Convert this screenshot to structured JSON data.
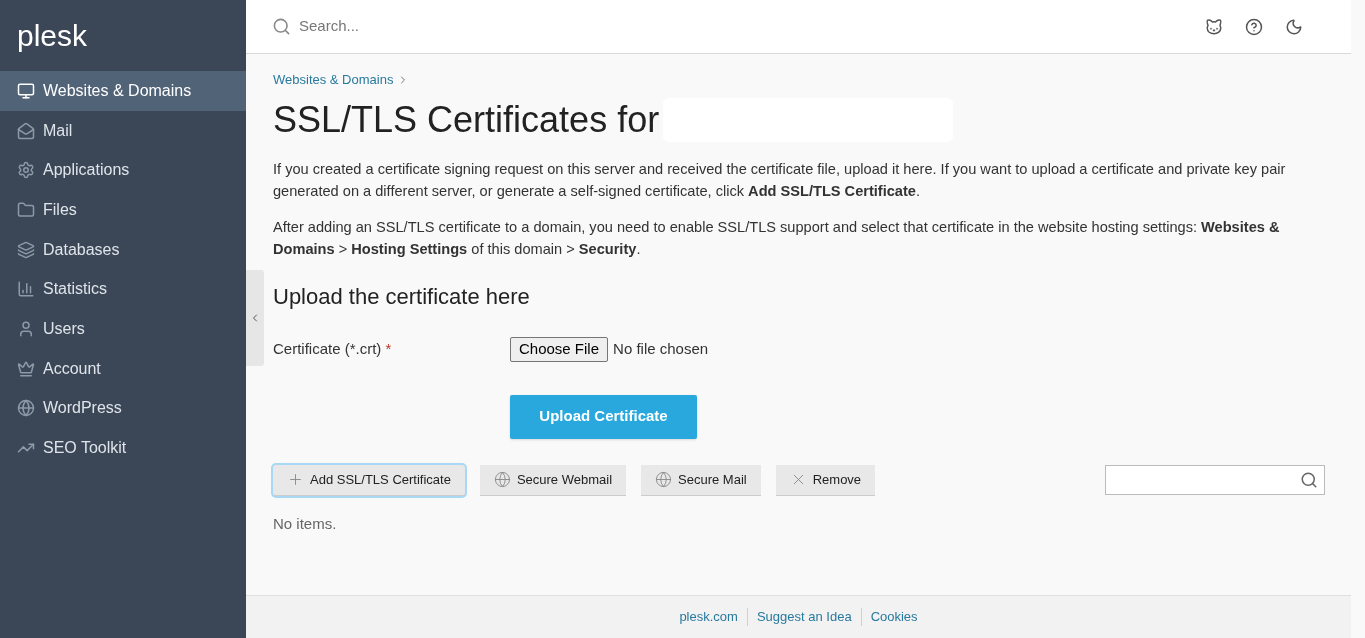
{
  "logo": "plesk",
  "sidebar": {
    "items": [
      {
        "label": "Websites & Domains",
        "selected": true
      },
      {
        "label": "Mail",
        "selected": false
      },
      {
        "label": "Applications",
        "selected": false
      },
      {
        "label": "Files",
        "selected": false
      },
      {
        "label": "Databases",
        "selected": false
      },
      {
        "label": "Statistics",
        "selected": false
      },
      {
        "label": "Users",
        "selected": false
      },
      {
        "label": "Account",
        "selected": false
      },
      {
        "label": "WordPress",
        "selected": false
      },
      {
        "label": "SEO Toolkit",
        "selected": false
      }
    ]
  },
  "search": {
    "placeholder": "Search..."
  },
  "breadcrumb": [
    "Websites & Domains"
  ],
  "page_title": "SSL/TLS Certificates for",
  "paragraphs": [
    "If you created a certificate signing request on this server and received the certificate file, upload it here. If you want to upload a certificate and private key pair generated on a different server, or generate a self-signed certificate, click **Add SSL/TLS Certificate**.",
    "After adding an SSL/TLS certificate to a domain, you need to enable SSL/TLS support and select that certificate in the website hosting settings: **Websites & Domains** > **Hosting Settings** of this domain > **Security**."
  ],
  "upload": {
    "heading": "Upload the certificate here",
    "label": "Certificate (*.crt)",
    "required_mark": "*",
    "file_button": "Choose File",
    "file_status": "No file chosen",
    "submit": "Upload Certificate"
  },
  "toolbar": [
    {
      "label": "Add SSL/TLS Certificate",
      "focused": true
    },
    {
      "label": "Secure Webmail",
      "focused": false
    },
    {
      "label": "Secure Mail",
      "focused": false
    },
    {
      "label": "Remove",
      "focused": false
    }
  ],
  "empty_message": "No items.",
  "footer_links": [
    "plesk.com",
    "Suggest an Idea",
    "Cookies"
  ]
}
